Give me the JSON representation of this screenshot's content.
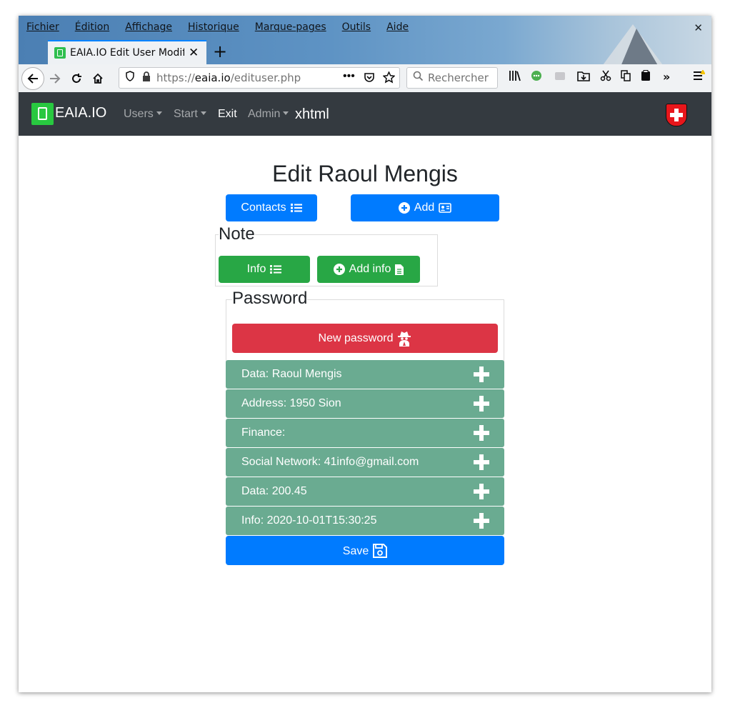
{
  "browser": {
    "menu": [
      "Fichier",
      "Édition",
      "Affichage",
      "Historique",
      "Marque-pages",
      "Outils",
      "Aide"
    ],
    "tab_title": "EAIA.IO Edit User Modify",
    "url_prefix": "https://",
    "url_host": "eaia.io",
    "url_path": "/edituser.php",
    "search_placeholder": "Rechercher"
  },
  "site_nav": {
    "brand": "EAIA.IO",
    "links": [
      {
        "label": "Users",
        "dropdown": true
      },
      {
        "label": "Start",
        "dropdown": true
      },
      {
        "label": "Exit",
        "dropdown": false
      },
      {
        "label": "Admin",
        "dropdown": true
      }
    ],
    "format": "xhtml"
  },
  "page": {
    "title": "Edit Raoul Mengis",
    "contacts_button": "Contacts",
    "add_button": "Add",
    "note_legend": "Note",
    "info_button": "Info",
    "add_info_button": "Add info",
    "password_legend": "Password",
    "new_password_button": "New password",
    "sections": [
      "Data: Raoul Mengis",
      "Address: 1950 Sion",
      "Finance:",
      "Social Network: 41info@gmail.com",
      "Data: 200.45",
      "Info: 2020-10-01T15:30:25"
    ],
    "save_button": "Save"
  },
  "colors": {
    "navbar": "#343a40",
    "primary": "#007bff",
    "success": "#28a745",
    "danger": "#dc3545",
    "accordion": "#6aab91"
  }
}
